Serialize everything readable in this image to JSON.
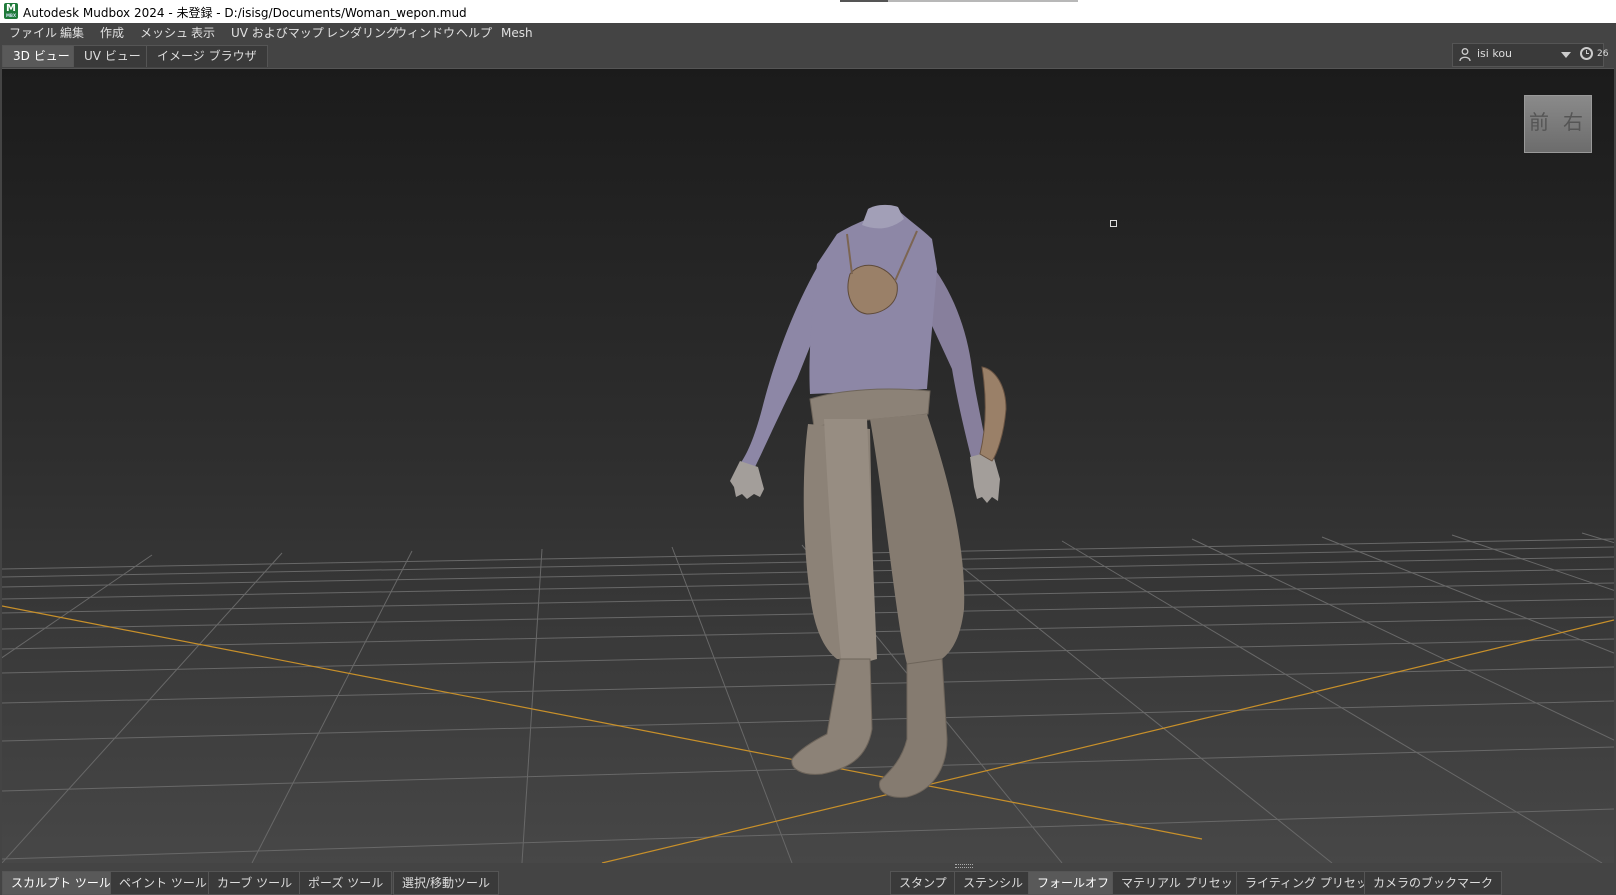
{
  "window": {
    "title": "Autodesk Mudbox 2024 - 未登録 - D:/isisg/Documents/Woman_wepon.mud",
    "logo_letter": "M",
    "logo_sub": "MBX"
  },
  "menubar": {
    "items": [
      "ファイル",
      "編集",
      "作成",
      "メッシュ",
      "表示",
      "UV およびマップ",
      "レンダリング",
      "ウィンドウ",
      "ヘルプ",
      "Mesh"
    ]
  },
  "view_tabs": {
    "items": [
      "3D ビュー",
      "UV ビュー",
      "イメージ ブラウザ"
    ],
    "active": "3D ビュー"
  },
  "user": {
    "name": "isi kou",
    "clock_value": "26"
  },
  "viewcube": {
    "front": "前",
    "right": "右"
  },
  "tool_tabs": {
    "items": [
      "スカルプト ツール",
      "ペイント ツール",
      "カーブ ツール",
      "ポーズ ツール",
      "選択/移動ツール"
    ],
    "active": "スカルプト ツール"
  },
  "tray_tabs": {
    "items": [
      "スタンプ",
      "ステンシル",
      "フォールオフ",
      "マテリアル プリセット",
      "ライティング プリセット",
      "カメラのブックマーク"
    ],
    "active": "フォールオフ"
  },
  "colors": {
    "grid_line": "#6a6a6a",
    "axis_line": "#c8902a",
    "shirt": "#8d87a6",
    "pants": "#8c8277",
    "skin": "#a39e9a",
    "leather": "#9a8068"
  },
  "icons": [
    "user-icon",
    "dropdown-caret-icon",
    "clock-icon",
    "app-logo-icon",
    "viewcube-icon"
  ]
}
